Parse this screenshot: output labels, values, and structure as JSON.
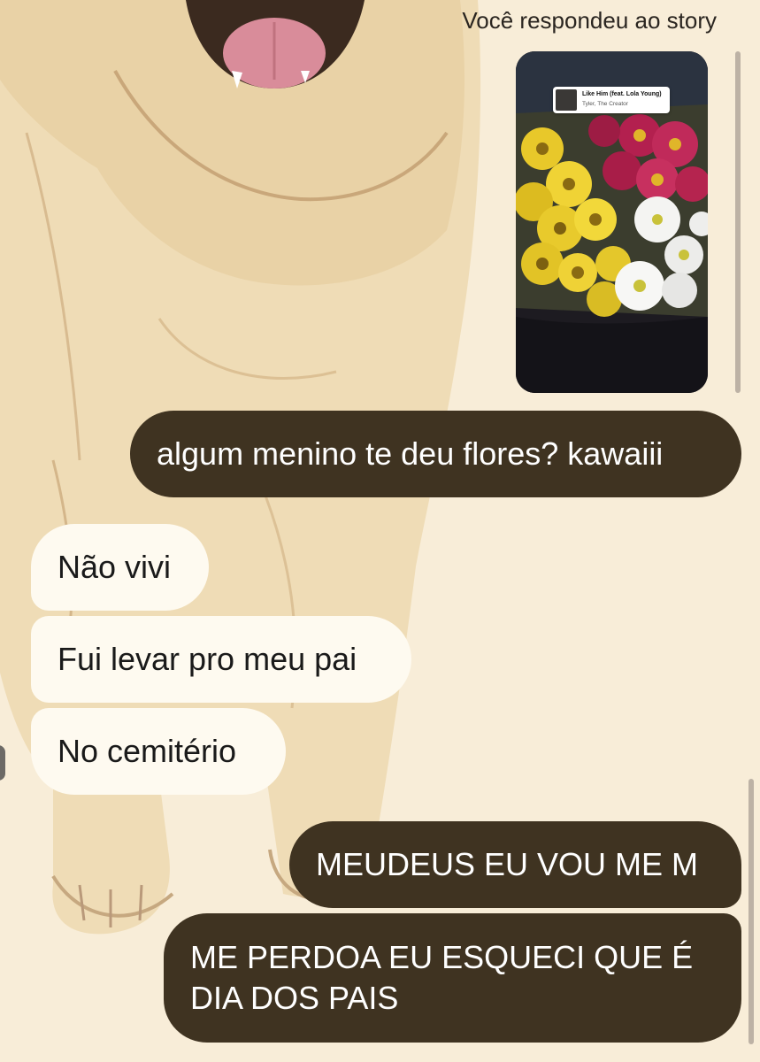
{
  "story_reply": {
    "caption": "Você respondeu ao story",
    "music_sticker": {
      "title": "Like Him (feat. Lola Young)",
      "artist": "Tyler, The Creator"
    }
  },
  "messages": [
    {
      "side": "sent",
      "text": "algum menino te deu flores? kawaiii"
    },
    {
      "side": "received",
      "text": "Não vivi"
    },
    {
      "side": "received",
      "text": "Fui levar pro meu pai"
    },
    {
      "side": "received",
      "text": "No cemitério"
    },
    {
      "side": "sent",
      "text": "MEUDEUS EU VOU ME M"
    },
    {
      "side": "sent",
      "text": "ME PERDOA EU ESQUECI QUE É DIA DOS PAIS"
    }
  ],
  "colors": {
    "background": "#f8edd8",
    "sent_bubble": "#3f3321",
    "received_bubble": "#fefaf0"
  },
  "icons": {
    "background_wallpaper": "golden-retriever-illustration",
    "story_photo": "flower-bouquet-photo"
  }
}
